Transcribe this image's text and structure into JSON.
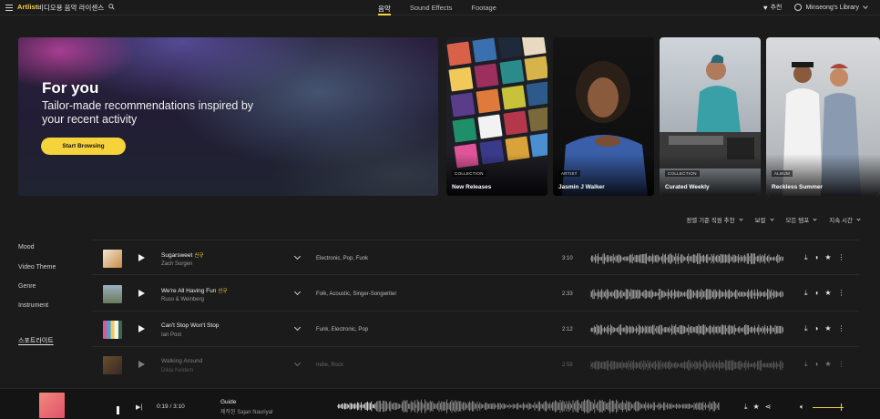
{
  "nav": {
    "logo": "Artlist",
    "subtitle": "비디오용 음악 라이센스",
    "tabs": [
      {
        "label": "음악",
        "active": true
      },
      {
        "label": "Sound Effects",
        "active": false
      },
      {
        "label": "Footage",
        "active": false
      }
    ],
    "favorites_label": "추천",
    "library_label": "Minseong's Library"
  },
  "hero": {
    "title": "For you",
    "subtitle": "Tailor-made recommendations inspired by your recent activity",
    "button_label": "Start Browsing"
  },
  "cards": [
    {
      "badge": "COLLECTION",
      "label": "New Releases"
    },
    {
      "badge": "ARTIST",
      "label": "Jasmin J Walker"
    },
    {
      "badge": "COLLECTION",
      "label": "Curated Weekly"
    },
    {
      "badge": "ALBUM",
      "label": "Reckless Summer"
    }
  ],
  "filters": [
    "정렬 기준 직원 추천",
    "보컬",
    "모든 템포",
    "지속 시간"
  ],
  "sidebar": [
    "Mood",
    "Video Theme",
    "Genre",
    "Instrument",
    "스포트라이트"
  ],
  "tracks": [
    {
      "title": "Sugarsweet",
      "new": "신규",
      "artist": "Zach Sorgen",
      "tags": "Electronic,  Pop,  Funk",
      "duration": "3:10"
    },
    {
      "title": "We're All Having Fun",
      "new": "신규",
      "artist": "Ruso & Weinberg",
      "tags": "Folk,  Acoustic,  Singer-Songwriter",
      "duration": "2:33"
    },
    {
      "title": "Can't Stop Won't Stop",
      "new": "",
      "artist": "Ian Post",
      "tags": "Funk,  Electronic,  Pop",
      "duration": "2:12"
    },
    {
      "title": "Walking Around",
      "new": "",
      "artist": "Dikla Keidem",
      "tags": "Indie,  Rock",
      "duration": "2:58"
    }
  ],
  "player": {
    "time": "0:19 / 3:10",
    "title": "Guide",
    "artist": "제작된 Sajan Nauriyal",
    "progress": 0.1,
    "volume": 0.95
  },
  "colors": {
    "accent": "#f5d33a",
    "background": "#1b1b1b"
  },
  "icons": [
    "menu-icon",
    "search-icon",
    "heart-icon",
    "user-icon",
    "play-icon",
    "chevron-down-icon",
    "download-icon",
    "similar-icon",
    "star-icon",
    "more-icon",
    "pause-icon",
    "next-icon",
    "share-icon",
    "volume-icon"
  ]
}
